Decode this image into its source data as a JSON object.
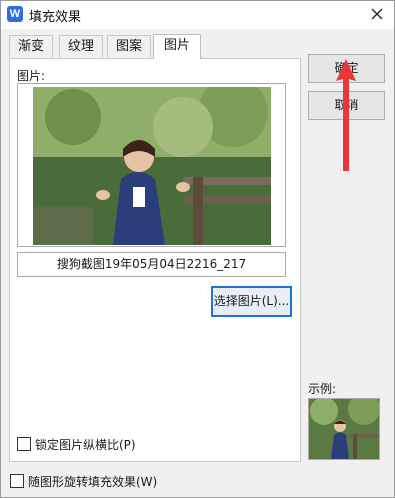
{
  "window": {
    "title": "填充效果",
    "app_icon": "W"
  },
  "tabs": [
    {
      "label": "渐变"
    },
    {
      "label": "纹理"
    },
    {
      "label": "图案"
    },
    {
      "label": "图片"
    }
  ],
  "picture_section": {
    "label": "图片:",
    "filename": "搜狗截图19年05月04日2216_217",
    "select_button": "选择图片(L)..."
  },
  "buttons": {
    "ok": "确定",
    "cancel": "取消"
  },
  "options": {
    "lock_aspect": "锁定图片纵横比(P)",
    "rotate_with_shape": "随图形旋转填充效果(W)"
  },
  "example": {
    "label": "示例:"
  },
  "icons": {
    "close": "close-icon",
    "app": "wps-writer-icon",
    "annotation": "red-arrow-icon"
  },
  "colors": {
    "accent": "#1e73d6",
    "annotation_red": "#e8363b",
    "icon_blue": "#2b6fe6"
  }
}
